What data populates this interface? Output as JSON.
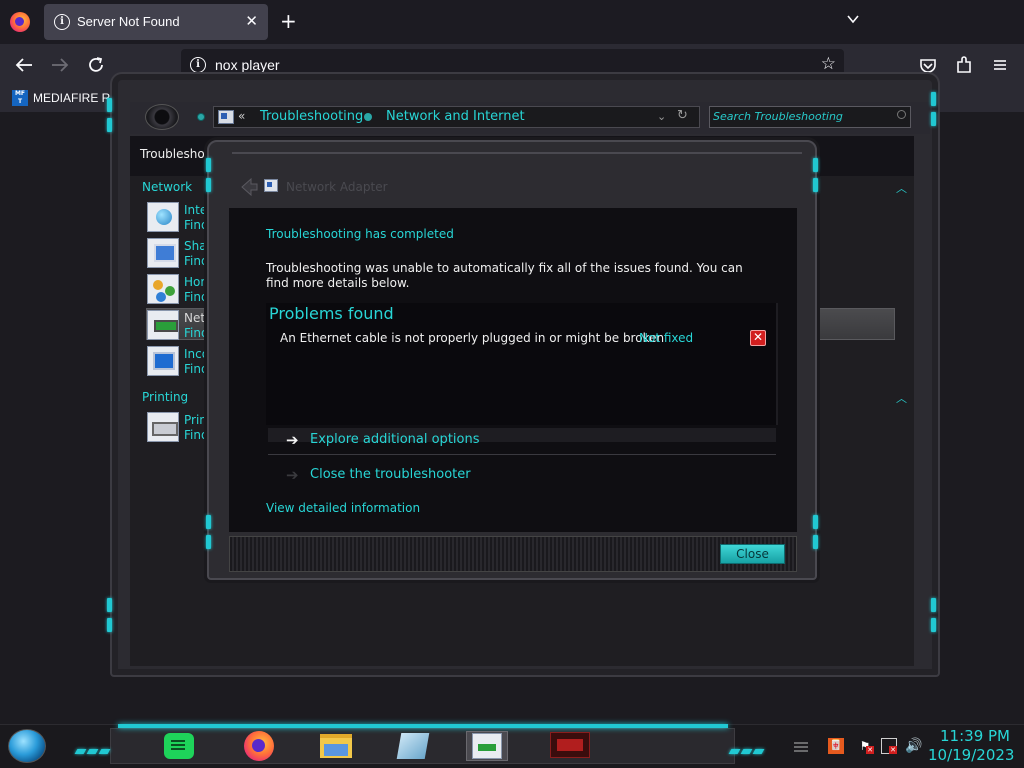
{
  "browser": {
    "tab_title": "Server Not Found",
    "tab_close": "✕",
    "new_tab": "+",
    "url": "nox player",
    "bookmark_label": "MEDIAFIRE RO",
    "bookmark_icon_text": "MF T"
  },
  "window": {
    "breadcrumb": [
      "Troubleshooting",
      "Network and Internet"
    ],
    "search_placeholder": "Search Troubleshooting",
    "header_title": "Troubleshoo",
    "sections": [
      {
        "label": "Network"
      },
      {
        "label": "Printing"
      }
    ],
    "items": [
      {
        "title": "Inter",
        "sub": "Find"
      },
      {
        "title": "Share",
        "sub": "Find"
      },
      {
        "title": "Hom",
        "sub": "Find"
      },
      {
        "title": "Netw",
        "sub": "Find"
      },
      {
        "title": "Incor",
        "sub": "Find"
      },
      {
        "title": "Printe",
        "sub": "Find"
      }
    ]
  },
  "dialog": {
    "header_title": "Network Adapter",
    "status": "Troubleshooting has completed",
    "description": "Troubleshooting was unable to automatically fix all of the issues found. You can find more details below.",
    "problems_title": "Problems found",
    "problems": [
      {
        "text": "An Ethernet cable is not properly plugged in or might be broken",
        "status": "Not fixed"
      }
    ],
    "explore_label": "Explore additional options",
    "close_troubleshooter_label": "Close the troubleshooter",
    "details_link": "View detailed information",
    "close_button": "Close"
  },
  "taskbar": {
    "time": "11:39 PM",
    "date": "10/19/2023",
    "tray_lang": "\u0001"
  },
  "colors": {
    "accent_cyan": "#28d6d6",
    "led_cyan": "#21c8d2",
    "browser_chrome": "#2b2a33",
    "error_red": "#d21f1f"
  }
}
